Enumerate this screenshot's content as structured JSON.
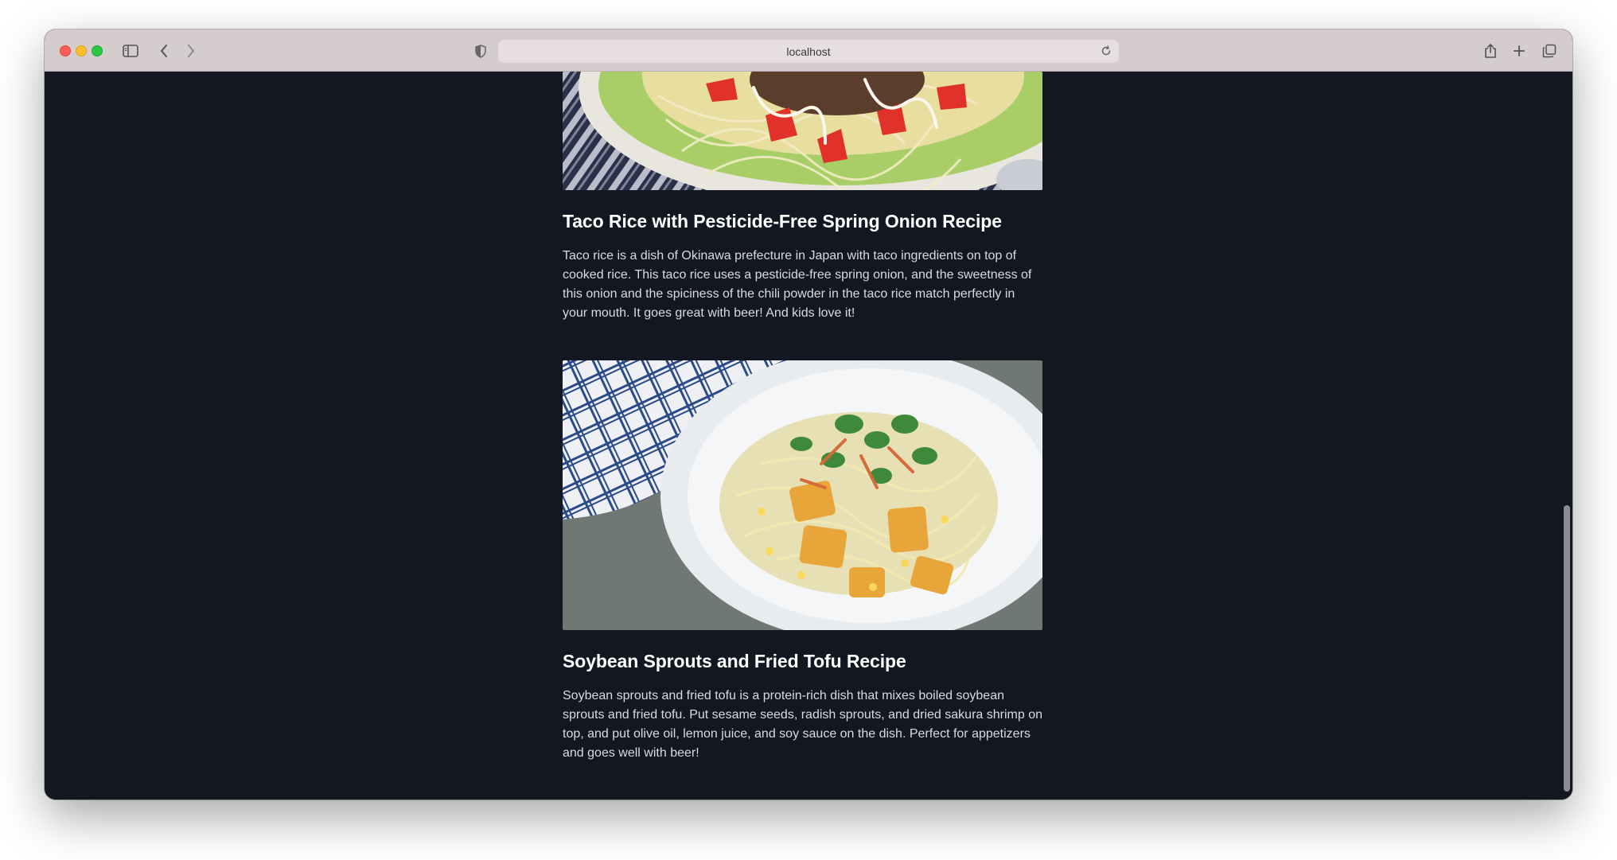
{
  "browser": {
    "url": "localhost"
  },
  "recipes": [
    {
      "title": "Taco Rice with Pesticide-Free Spring Onion Recipe",
      "description": "Taco rice is a dish of Okinawa prefecture in Japan with taco ingredients on top of cooked rice. This taco rice uses a pesticide-free spring onion, and the sweetness of this onion and the spiciness of the chili powder in the taco rice match perfectly in your mouth. It goes great with beer! And kids love it!"
    },
    {
      "title": "Soybean Sprouts and Fried Tofu Recipe",
      "description": "Soybean sprouts and fried tofu is a protein-rich dish that mixes boiled soybean sprouts and fried tofu. Put sesame seeds, radish sprouts, and dried sakura shrimp on top, and put olive oil, lemon juice, and soy sauce on the dish. Perfect for appetizers and goes well with beer!"
    }
  ],
  "colors": {
    "page_background": "#131722",
    "heading": "#ffffff",
    "body_text": "#d8dbe2",
    "toolbar": "#d5ccce"
  }
}
